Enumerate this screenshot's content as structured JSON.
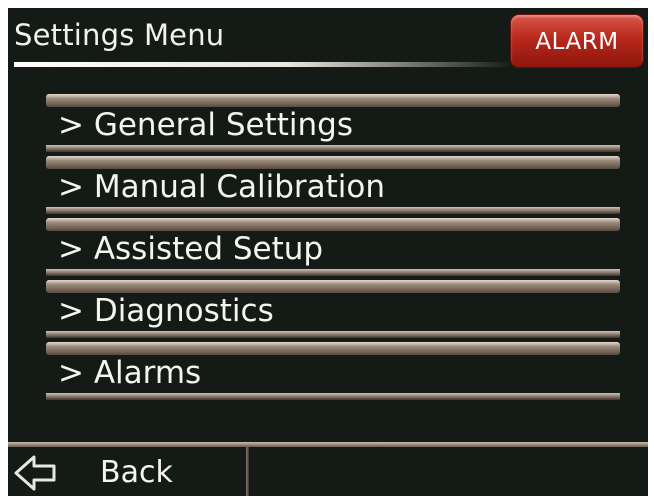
{
  "header": {
    "title": "Settings Menu",
    "alarm_label": "ALARM"
  },
  "menu": {
    "items": [
      {
        "label": "> General Settings"
      },
      {
        "label": "> Manual Calibration"
      },
      {
        "label": "> Assisted Setup"
      },
      {
        "label": "> Diagnostics"
      },
      {
        "label": "> Alarms"
      }
    ]
  },
  "footer": {
    "back_label": "Back",
    "back_icon": "back-arrow-icon"
  },
  "colors": {
    "background": "#141b17",
    "alarm": "#b8281c",
    "text": "#f5f5ee"
  }
}
